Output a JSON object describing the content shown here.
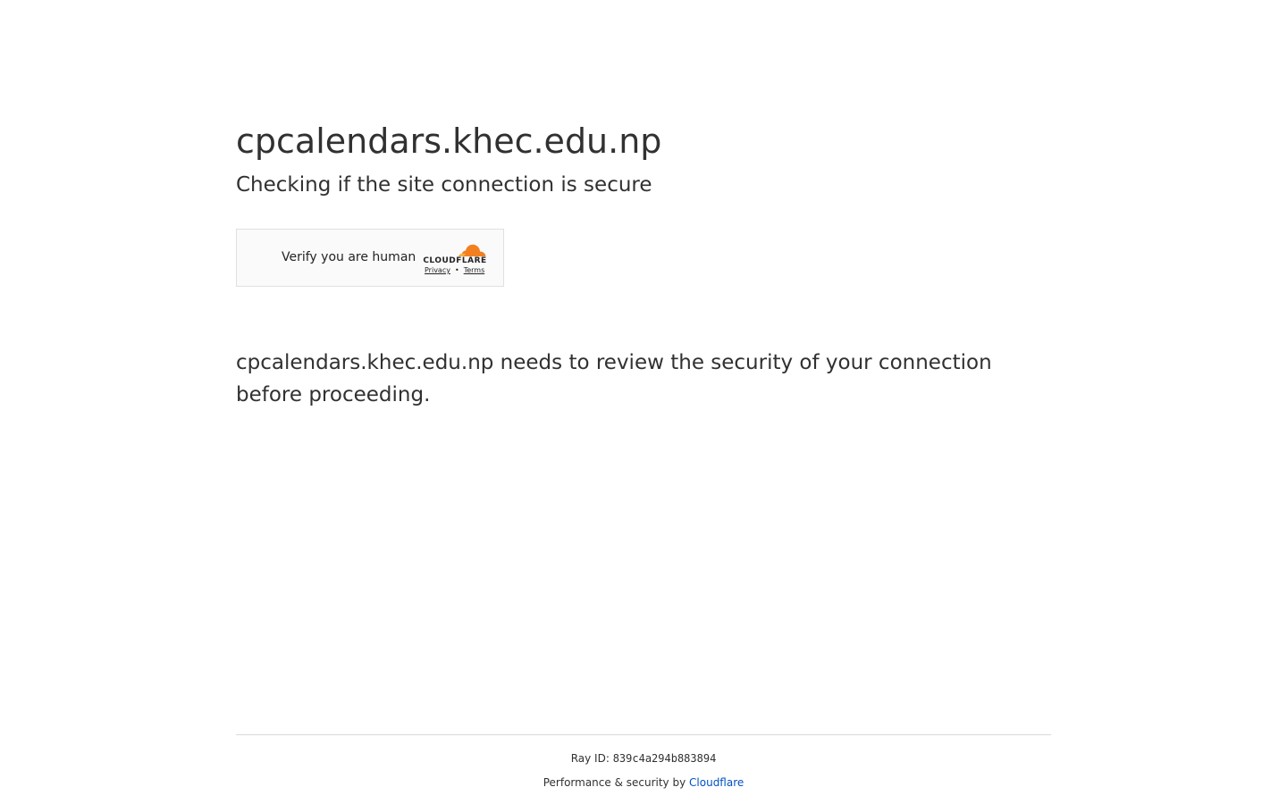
{
  "page": {
    "site_name": "cpcalendars.khec.edu.np",
    "subtitle": "Checking if the site connection is secure",
    "message": "cpcalendars.khec.edu.np needs to review the security of your connection before proceeding."
  },
  "widget": {
    "label": "Verify you are human",
    "brand": "CLOUDFLARE",
    "privacy_link": "Privacy",
    "separator": "•",
    "terms_link": "Terms",
    "brand_color": "#f38020"
  },
  "footer": {
    "ray_label": "Ray ID:",
    "ray_id": "839c4a294b883894",
    "performance_text": "Performance & security by",
    "cloudflare_link": "Cloudflare",
    "link_color": "#0051c3"
  }
}
